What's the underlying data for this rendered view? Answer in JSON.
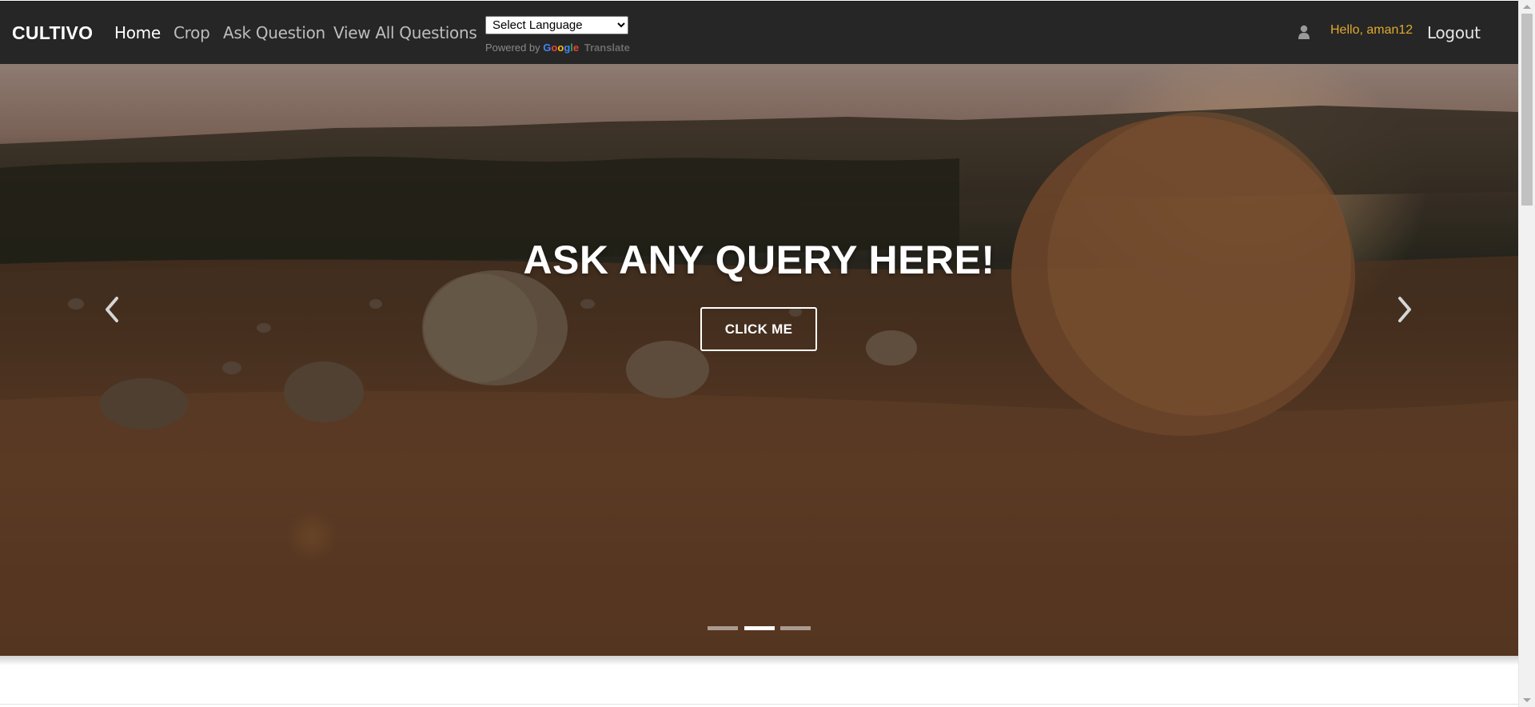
{
  "navbar": {
    "brand": "CULTIVO",
    "links": [
      {
        "label": "Home",
        "active": true
      },
      {
        "label": "Crop",
        "active": false
      },
      {
        "label": "Ask Question",
        "active": false
      },
      {
        "label": "View All Questions",
        "active": false
      }
    ],
    "language_select": {
      "value": "Select Language",
      "options": [
        "Select Language"
      ]
    },
    "powered_by": {
      "prefix": "Powered by",
      "google": "Google",
      "translate": "Translate"
    },
    "user_icon": "user-icon",
    "greeting": "Hello, aman12",
    "logout_label": "Logout"
  },
  "hero": {
    "heading": "ASK ANY QUERY HERE!",
    "button_label": "CLICK ME",
    "prev_icon": "chevron-left-icon",
    "next_icon": "chevron-right-icon",
    "slide_count": 3,
    "active_slide": 2
  },
  "colors": {
    "navbar_bg": "#262626",
    "greeting": "#e0a92b",
    "link_inactive": "#bdbdbd",
    "link_active": "#ffffff"
  }
}
